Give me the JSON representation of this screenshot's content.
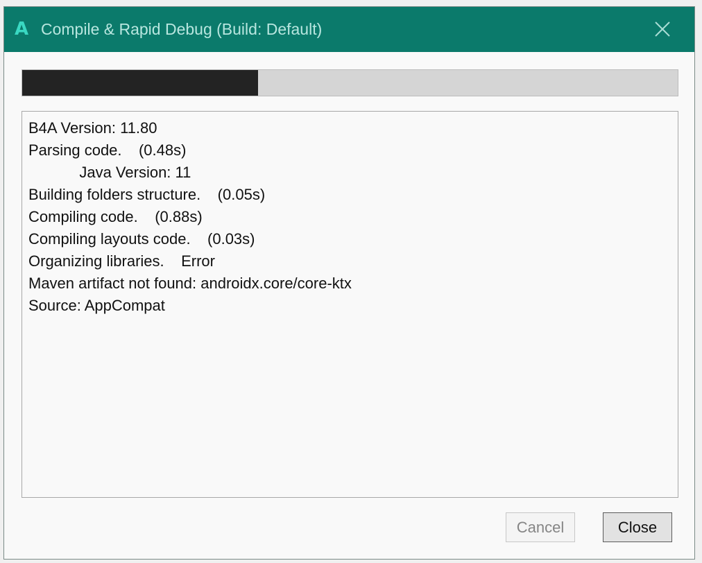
{
  "window": {
    "title": "Compile & Rapid Debug (Build: Default)",
    "app_logo": "A",
    "accent_color": "#0b7a6b",
    "logo_color": "#3ad8c2",
    "close_icon": "close-icon"
  },
  "progress": {
    "fraction": 0.36
  },
  "log": {
    "lines": [
      "B4A Version: 11.80",
      "Parsing code.    (0.48s)",
      "            Java Version: 11",
      "Building folders structure.    (0.05s)",
      "Compiling code.    (0.88s)",
      "Compiling layouts code.    (0.03s)",
      "Organizing libraries.    Error",
      "Maven artifact not found: androidx.core/core-ktx",
      "Source: AppCompat"
    ]
  },
  "buttons": {
    "cancel_label": "Cancel",
    "cancel_enabled": false,
    "close_label": "Close"
  }
}
